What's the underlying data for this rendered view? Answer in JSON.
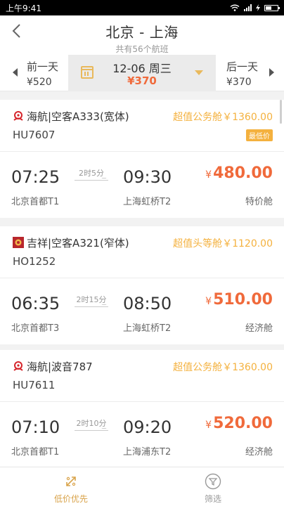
{
  "status": {
    "time": "上午9:41"
  },
  "header": {
    "title": "北京 - 上海",
    "subtitle": "共有56个航班"
  },
  "datebar": {
    "prev": {
      "label": "前一天",
      "price": "¥520"
    },
    "selected": {
      "date": "12-06 周三",
      "price": "¥370"
    },
    "next": {
      "label": "后一天",
      "price": "¥370"
    }
  },
  "flights": [
    {
      "airline": "海航|空客A333(宽体)",
      "flight_no": "HU7607",
      "promo": "超值公务舱￥1360.00",
      "badge": "最低价",
      "dep_time": "07:25",
      "arr_time": "09:30",
      "duration": "2时5分",
      "dep_airport": "北京首都T1",
      "arr_airport": "上海虹桥T2",
      "price_symbol": "¥",
      "price": "480.00",
      "cabin": "特价舱"
    },
    {
      "airline": "吉祥|空客A321(窄体)",
      "flight_no": "HO1252",
      "promo": "超值头等舱￥1120.00",
      "dep_time": "06:35",
      "arr_time": "08:50",
      "duration": "2时15分",
      "dep_airport": "北京首都T3",
      "arr_airport": "上海虹桥T2",
      "price_symbol": "¥",
      "price": "510.00",
      "cabin": "经济舱"
    },
    {
      "airline": "海航|波音787",
      "flight_no": "HU7611",
      "promo": "超值公务舱￥1360.00",
      "dep_time": "07:10",
      "arr_time": "09:20",
      "duration": "2时10分",
      "dep_airport": "北京首都T1",
      "arr_airport": "上海浦东T2",
      "price_symbol": "¥",
      "price": "520.00",
      "cabin": "经济舱"
    }
  ],
  "tabbar": {
    "lowest_price": "低价优先",
    "filter": "筛选"
  },
  "colors": {
    "accent": "#f06a3b",
    "promo": "#f4b13e",
    "tab_active": "#d9a34a"
  }
}
